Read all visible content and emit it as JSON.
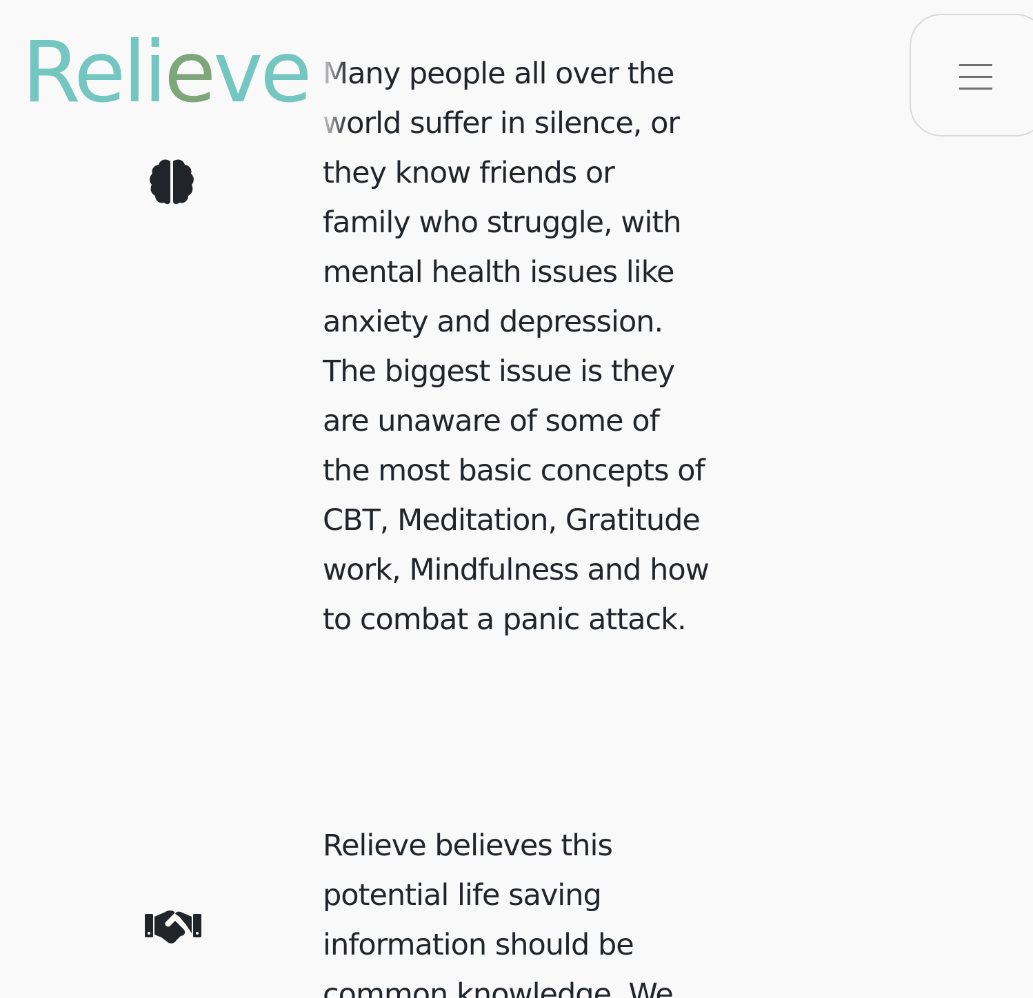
{
  "header": {
    "logo": {
      "part_a": "Reli",
      "part_b": "e",
      "part_c": "ve",
      "colors": {
        "primary": "#74c6c0",
        "accent": "#7fa57a"
      }
    },
    "menu_button": {
      "icon": "hamburger-menu-icon",
      "border_color": "#d9d9d9"
    }
  },
  "sections": [
    {
      "icon": "brain-icon",
      "text": "Many people all over the world suffer in silence, or they know friends or family who struggle, with mental health issues like anxiety and depression. The biggest issue is they are unaware of some of the most basic concepts of CBT, Meditation, Gratitude work, Mindfulness and how to combat a panic attack."
    },
    {
      "icon": "handshake-icon",
      "text": "Relieve believes this potential life saving information should be common knowledge. We"
    }
  ],
  "colors": {
    "background": "#f9f9f9",
    "text": "#212529",
    "icon": "#212529"
  }
}
